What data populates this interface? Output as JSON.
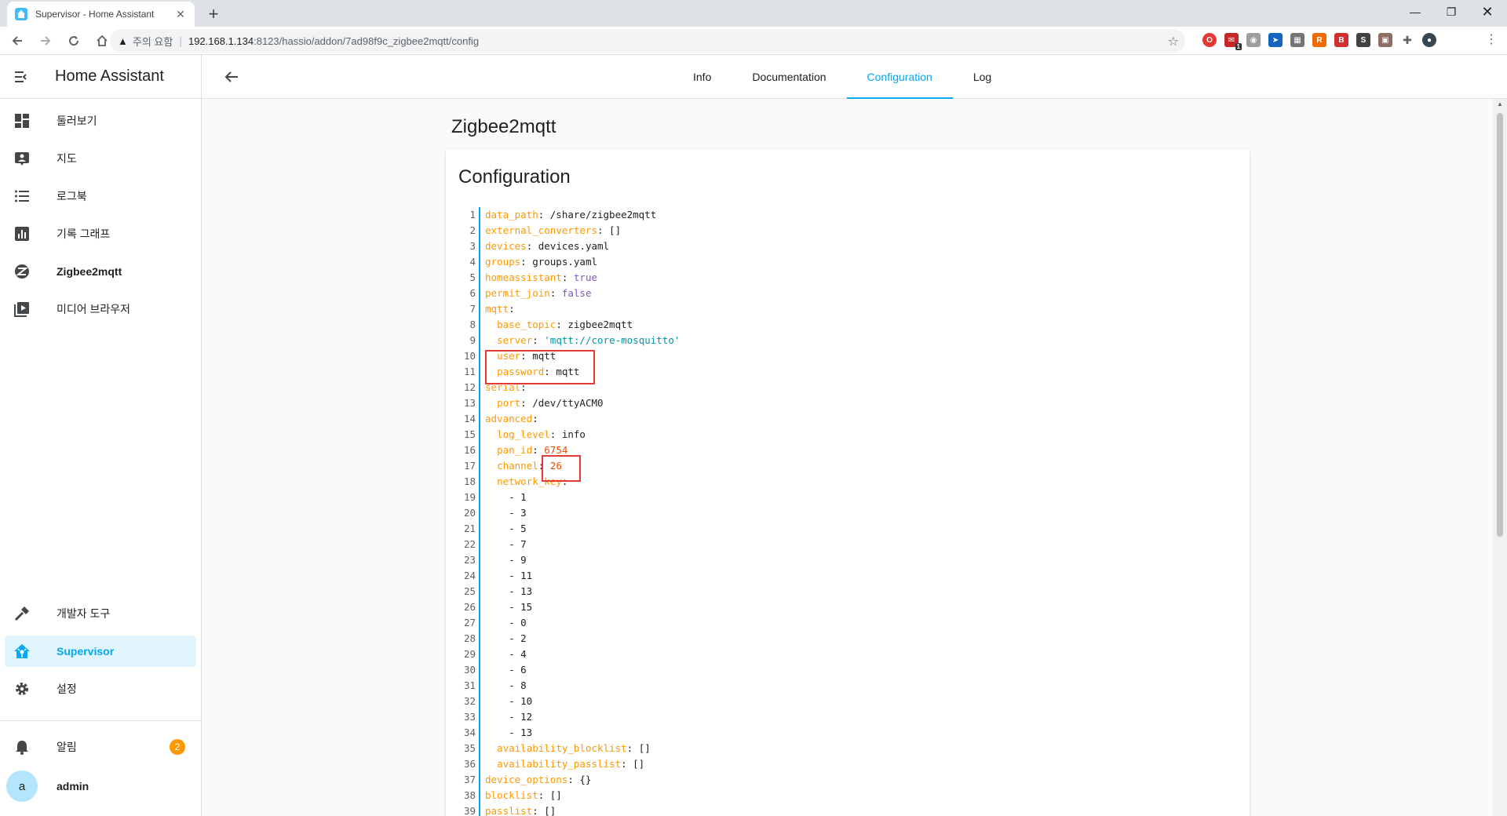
{
  "browser": {
    "tab_title": "Supervisor - Home Assistant",
    "new_tab": "+",
    "warning_label": "주의 요함",
    "url_host": "192.168.1.134",
    "url_path": ":8123/hassio/addon/7ad98f9c_zigbee2mqtt/config",
    "extension_badge": "1"
  },
  "sidebar": {
    "title": "Home Assistant",
    "items": [
      {
        "label": "둘러보기",
        "icon": "dashboard-icon"
      },
      {
        "label": "지도",
        "icon": "map-icon"
      },
      {
        "label": "로그북",
        "icon": "logbook-icon"
      },
      {
        "label": "기록 그래프",
        "icon": "history-icon"
      },
      {
        "label": "Zigbee2mqtt",
        "icon": "zigbee-icon"
      },
      {
        "label": "미디어 브라우저",
        "icon": "media-icon"
      }
    ],
    "bottom_items": [
      {
        "label": "개발자 도구",
        "icon": "hammer-icon"
      },
      {
        "label": "Supervisor",
        "icon": "supervisor-icon"
      },
      {
        "label": "설정",
        "icon": "gear-icon"
      }
    ],
    "notifications": {
      "label": "알림",
      "count": "2"
    },
    "user": {
      "initial": "a",
      "name": "admin"
    }
  },
  "tabs": [
    "Info",
    "Documentation",
    "Configuration",
    "Log"
  ],
  "active_tab": "Configuration",
  "addon_name": "Zigbee2mqtt",
  "card_title": "Configuration",
  "accent_color": "#03a9f4",
  "highlight_color": "#e53935",
  "code_lines": [
    [
      [
        "k",
        "data_path"
      ],
      [
        "p",
        ": /share/zigbee2mqtt"
      ]
    ],
    [
      [
        "k",
        "external_converters"
      ],
      [
        "p",
        ": []"
      ]
    ],
    [
      [
        "k",
        "devices"
      ],
      [
        "p",
        ": devices.yaml"
      ]
    ],
    [
      [
        "k",
        "groups"
      ],
      [
        "p",
        ": groups.yaml"
      ]
    ],
    [
      [
        "k",
        "homeassistant"
      ],
      [
        "p",
        ": "
      ],
      [
        "b",
        "true"
      ]
    ],
    [
      [
        "k",
        "permit_join"
      ],
      [
        "p",
        ": "
      ],
      [
        "b",
        "false"
      ]
    ],
    [
      [
        "k",
        "mqtt"
      ],
      [
        "p",
        ":"
      ]
    ],
    [
      [
        "p",
        "  "
      ],
      [
        "k",
        "base_topic"
      ],
      [
        "p",
        ": zigbee2mqtt"
      ]
    ],
    [
      [
        "p",
        "  "
      ],
      [
        "k",
        "server"
      ],
      [
        "p",
        ": "
      ],
      [
        "s",
        "'mqtt://core-mosquitto'"
      ]
    ],
    [
      [
        "p",
        "  "
      ],
      [
        "k",
        "user"
      ],
      [
        "p",
        ": mqtt"
      ]
    ],
    [
      [
        "p",
        "  "
      ],
      [
        "k",
        "password"
      ],
      [
        "p",
        ": mqtt"
      ]
    ],
    [
      [
        "k",
        "serial"
      ],
      [
        "p",
        ":"
      ]
    ],
    [
      [
        "p",
        "  "
      ],
      [
        "k",
        "port"
      ],
      [
        "p",
        ": /dev/ttyACM0"
      ]
    ],
    [
      [
        "k",
        "advanced"
      ],
      [
        "p",
        ":"
      ]
    ],
    [
      [
        "p",
        "  "
      ],
      [
        "k",
        "log_level"
      ],
      [
        "p",
        ": info"
      ]
    ],
    [
      [
        "p",
        "  "
      ],
      [
        "k",
        "pan_id"
      ],
      [
        "p",
        ": "
      ],
      [
        "n",
        "6754"
      ]
    ],
    [
      [
        "p",
        "  "
      ],
      [
        "k",
        "channel"
      ],
      [
        "p",
        ": "
      ],
      [
        "n",
        "26"
      ]
    ],
    [
      [
        "p",
        "  "
      ],
      [
        "k",
        "network_key"
      ],
      [
        "p",
        ":"
      ]
    ],
    [
      [
        "p",
        "    - 1"
      ]
    ],
    [
      [
        "p",
        "    - 3"
      ]
    ],
    [
      [
        "p",
        "    - 5"
      ]
    ],
    [
      [
        "p",
        "    - 7"
      ]
    ],
    [
      [
        "p",
        "    - 9"
      ]
    ],
    [
      [
        "p",
        "    - 11"
      ]
    ],
    [
      [
        "p",
        "    - 13"
      ]
    ],
    [
      [
        "p",
        "    - 15"
      ]
    ],
    [
      [
        "p",
        "    - 0"
      ]
    ],
    [
      [
        "p",
        "    - 2"
      ]
    ],
    [
      [
        "p",
        "    - 4"
      ]
    ],
    [
      [
        "p",
        "    - 6"
      ]
    ],
    [
      [
        "p",
        "    - 8"
      ]
    ],
    [
      [
        "p",
        "    - 10"
      ]
    ],
    [
      [
        "p",
        "    - 12"
      ]
    ],
    [
      [
        "p",
        "    - 13"
      ]
    ],
    [
      [
        "p",
        "  "
      ],
      [
        "k",
        "availability_blocklist"
      ],
      [
        "p",
        ": []"
      ]
    ],
    [
      [
        "p",
        "  "
      ],
      [
        "k",
        "availability_passlist"
      ],
      [
        "p",
        ": []"
      ]
    ],
    [
      [
        "k",
        "device_options"
      ],
      [
        "p",
        ": {}"
      ]
    ],
    [
      [
        "k",
        "blocklist"
      ],
      [
        "p",
        ": []"
      ]
    ],
    [
      [
        "k",
        "passlist"
      ],
      [
        "p",
        ": []"
      ]
    ]
  ]
}
